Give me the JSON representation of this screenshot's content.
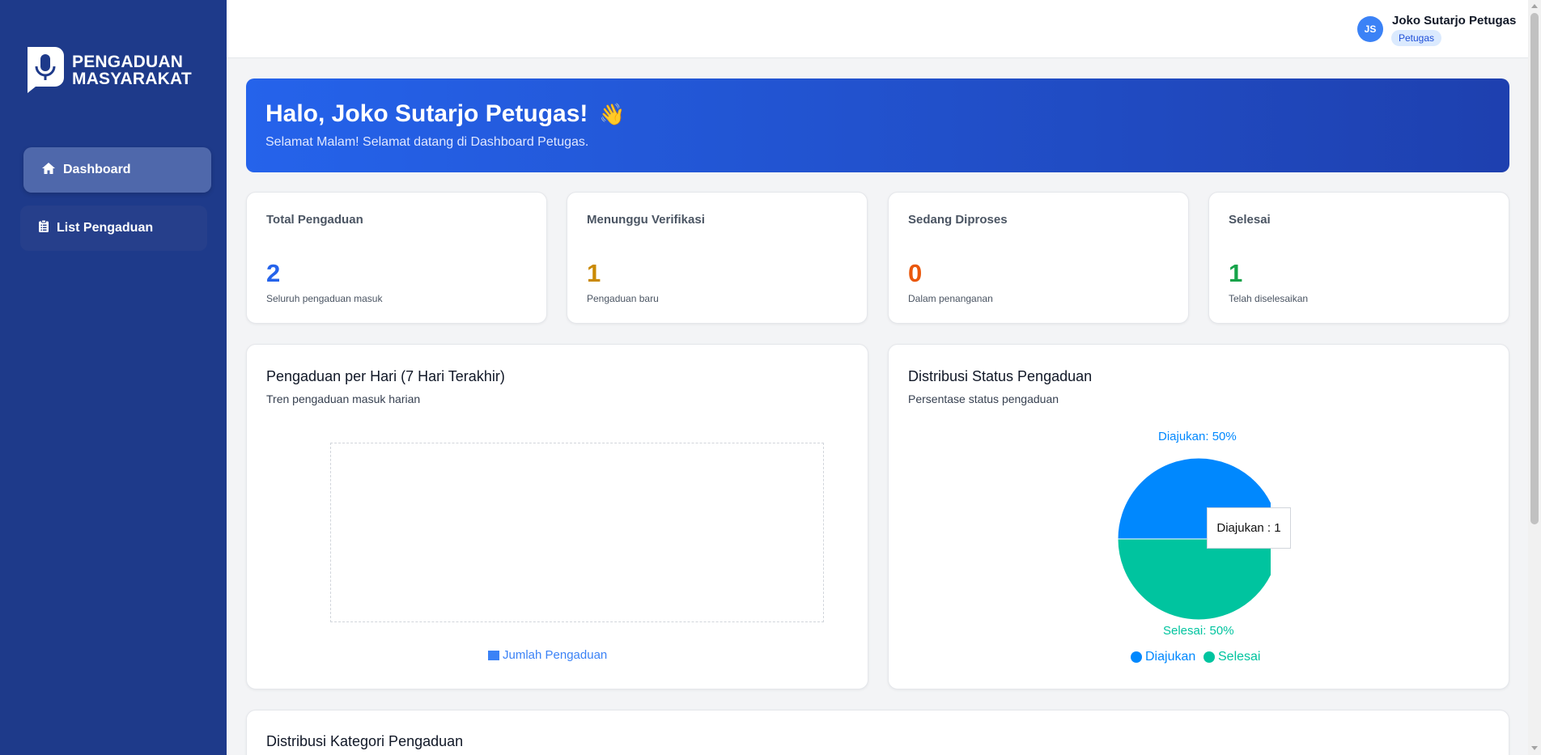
{
  "app": {
    "logo_line1": "PENGADUAN",
    "logo_line2": "MASYARAKAT"
  },
  "sidebar": {
    "items": [
      {
        "label": "Dashboard",
        "icon": "home-icon",
        "active": true
      },
      {
        "label": "List Pengaduan",
        "icon": "clipboard-icon",
        "active": false
      }
    ]
  },
  "user": {
    "initials": "JS",
    "name": "Joko Sutarjo Petugas",
    "role": "Petugas"
  },
  "banner": {
    "greeting": "Halo, Joko Sutarjo Petugas!",
    "emoji": "👋",
    "message": "Selamat Malam! Selamat datang di Dashboard Petugas."
  },
  "stats": [
    {
      "label": "Total Pengaduan",
      "value": "2",
      "sub": "Seluruh pengaduan masuk",
      "color": "#2563eb"
    },
    {
      "label": "Menunggu Verifikasi",
      "value": "1",
      "sub": "Pengaduan baru",
      "color": "#ca8a04"
    },
    {
      "label": "Sedang Diproses",
      "value": "0",
      "sub": "Dalam penanganan",
      "color": "#ea580c"
    },
    {
      "label": "Selesai",
      "value": "1",
      "sub": "Telah diselesaikan",
      "color": "#16a34a"
    }
  ],
  "daily_chart": {
    "title": "Pengaduan per Hari (7 Hari Terakhir)",
    "subtitle": "Tren pengaduan masuk harian",
    "legend": "Jumlah Pengaduan"
  },
  "status_chart": {
    "title": "Distribusi Status Pengaduan",
    "subtitle": "Persentase status pengaduan",
    "slice_label_top": "Diajukan: 50%",
    "slice_label_bottom": "Selesai: 50%",
    "tooltip": "Diajukan : 1",
    "legend": [
      "Diajukan",
      "Selesai"
    ]
  },
  "chart_data": [
    {
      "type": "line",
      "series": [
        {
          "name": "Jumlah Pengaduan",
          "values": []
        }
      ]
    },
    {
      "type": "pie",
      "categories": [
        "Diajukan",
        "Selesai"
      ],
      "values": [
        1,
        1
      ],
      "colors": [
        "#0088fe",
        "#00c49f"
      ]
    }
  ],
  "category_chart": {
    "title": "Distribusi Kategori Pengaduan"
  },
  "colors": {
    "sidebar": "#1e3a8a",
    "accent": "#2563eb"
  }
}
